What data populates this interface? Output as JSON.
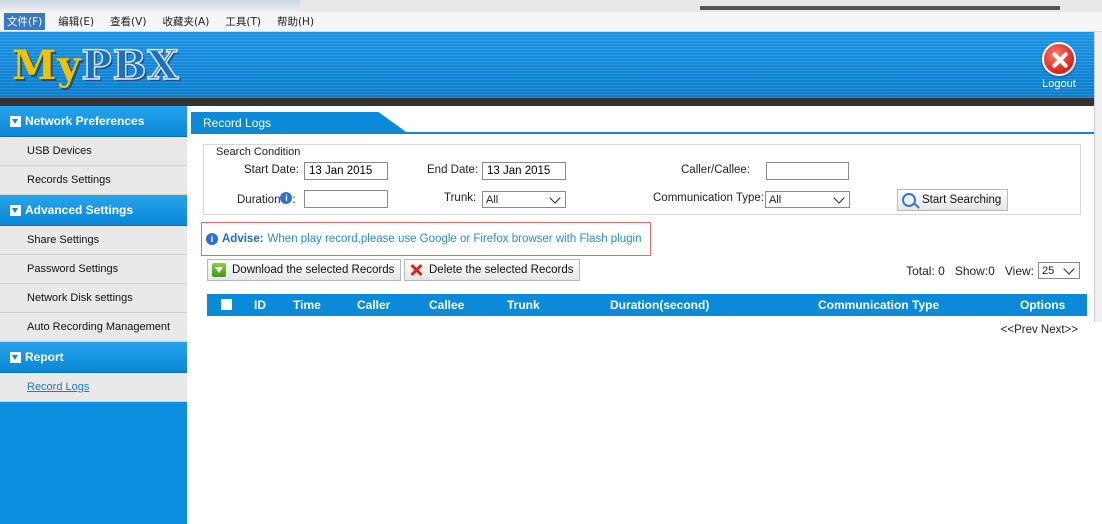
{
  "menubar": {
    "items": [
      "文件(F)",
      "编辑(E)",
      "查看(V)",
      "收藏夹(A)",
      "工具(T)",
      "帮助(H)"
    ]
  },
  "header": {
    "logo_my": "My",
    "logo_pbx": "PBX",
    "logout_label": "Logout"
  },
  "sidebar": {
    "sections": [
      {
        "title": "Network Preferences",
        "items": [
          "USB Devices",
          "Records Settings"
        ]
      },
      {
        "title": "Advanced Settings",
        "items": [
          "Share Settings",
          "Password Settings",
          "Network Disk settings",
          "Auto Recording Management"
        ]
      },
      {
        "title": "Report",
        "items": [
          "Record Logs"
        ]
      }
    ]
  },
  "main": {
    "tab_label": "Record Logs",
    "search": {
      "title": "Search Condition",
      "start_date_label": "Start Date:",
      "start_date_value": "13 Jan 2015",
      "end_date_label": "End Date:",
      "end_date_value": "13 Jan 2015",
      "caller_label": "Caller/Callee:",
      "caller_value": "",
      "duration_label": "Duration",
      "duration_colon": ":",
      "duration_value": "",
      "trunk_label": "Trunk:",
      "trunk_value": "All",
      "comm_type_label": "Communication Type:",
      "comm_type_value": "All",
      "start_search_label": "Start Searching"
    },
    "advise": {
      "bold": "Advise:",
      "text": "When play record,please use Google or Firefox browser with Flash plugin"
    },
    "download_label": "Download the selected Records",
    "delete_label": "Delete the selected Records",
    "totals": {
      "total": "Total: 0",
      "show": "Show:0",
      "view_label": "View:",
      "view_value": "25"
    },
    "columns": [
      "ID",
      "Time",
      "Caller",
      "Callee",
      "Trunk",
      "Duration(second)",
      "Communication Type",
      "Options"
    ],
    "pager": "<<Prev Next>>"
  }
}
